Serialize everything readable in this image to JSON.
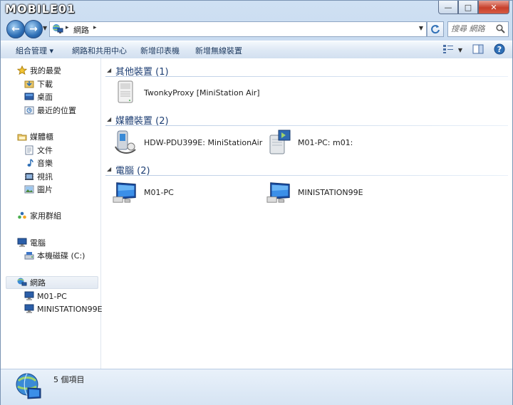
{
  "window": {
    "logo": "MOBILE01",
    "buttons": {
      "minimize": "—",
      "maximize": "□",
      "close": "✕"
    }
  },
  "nav": {
    "back": "←",
    "forward": "→",
    "breadcrumb": [
      "網路"
    ],
    "search_placeholder": "搜尋 網路"
  },
  "toolbar": {
    "organize": "組合管理 ▾",
    "network_center": "網路和共用中心",
    "add_printer": "新增印表機",
    "add_wireless": "新增無線裝置"
  },
  "sidebar": {
    "favorites": {
      "label": "我的最愛",
      "items": [
        "下載",
        "桌面",
        "最近的位置"
      ]
    },
    "libraries": {
      "label": "媒體櫃",
      "items": [
        "文件",
        "音樂",
        "視訊",
        "圖片"
      ]
    },
    "homegroup": "家用群組",
    "computer": {
      "label": "電腦",
      "items": [
        "本機磁碟 (C:)"
      ]
    },
    "network": {
      "label": "網路",
      "items": [
        "M01-PC",
        "MINISTATION99E"
      ]
    }
  },
  "groups": [
    {
      "title": "其他裝置 (1)",
      "items": [
        "TwonkyProxy [MiniStation Air]"
      ]
    },
    {
      "title": "媒體裝置 (2)",
      "items": [
        "HDW-PDU399E: MiniStationAir",
        "M01-PC: m01:"
      ]
    },
    {
      "title": "電腦 (2)",
      "items": [
        "M01-PC",
        "MINISTATION99E"
      ]
    }
  ],
  "status": {
    "count": "5 個項目"
  },
  "colors": {
    "accent": "#1e3f74",
    "frame": "#b9d1ea",
    "close": "#c7402b"
  }
}
